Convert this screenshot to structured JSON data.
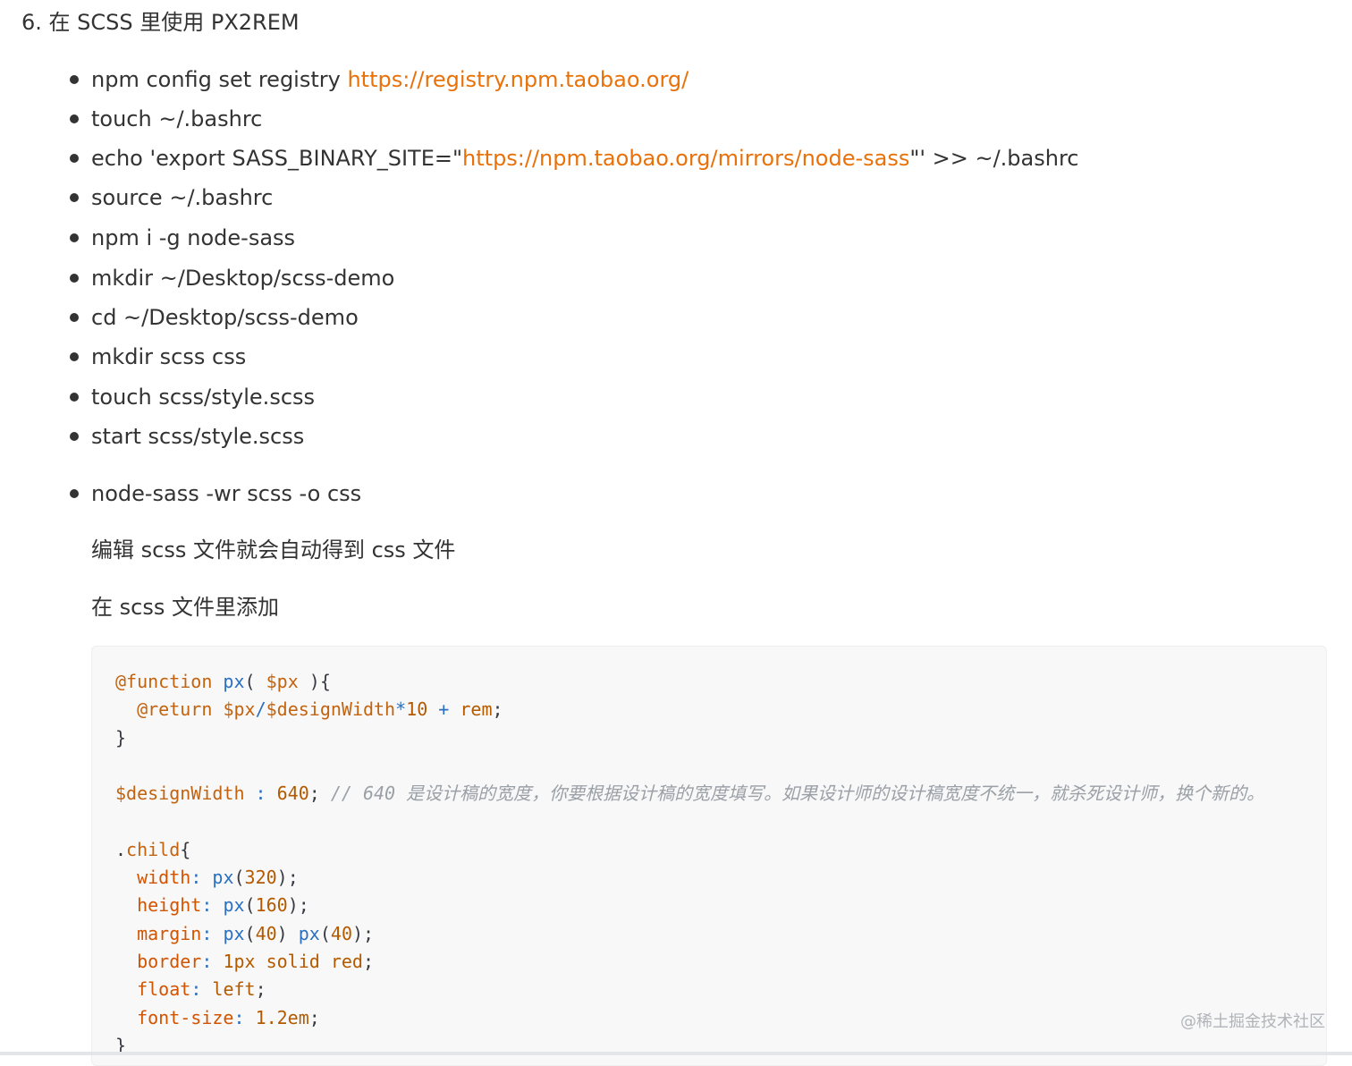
{
  "heading": "6. 在 SCSS 里使用 PX2REM",
  "commands": [
    {
      "pre": "npm config set registry ",
      "link": "https://registry.npm.taobao.org/",
      "post": ""
    },
    {
      "pre": "touch ~/.bashrc",
      "link": "",
      "post": ""
    },
    {
      "pre": "echo 'export SASS_BINARY_SITE=\"",
      "link": "https://npm.taobao.org/mirrors/node-sass",
      "post": "\"' >> ~/.bashrc"
    },
    {
      "pre": "source ~/.bashrc",
      "link": "",
      "post": ""
    },
    {
      "pre": "npm i -g node-sass",
      "link": "",
      "post": ""
    },
    {
      "pre": "mkdir ~/Desktop/scss-demo",
      "link": "",
      "post": ""
    },
    {
      "pre": "cd ~/Desktop/scss-demo",
      "link": "",
      "post": ""
    },
    {
      "pre": "mkdir scss css",
      "link": "",
      "post": ""
    },
    {
      "pre": "touch scss/style.scss",
      "link": "",
      "post": ""
    },
    {
      "pre": "start scss/style.scss",
      "link": "",
      "post": ""
    },
    {
      "pre": "node-sass -wr scss -o css",
      "link": "",
      "post": ""
    }
  ],
  "paragraphs": [
    "编辑 scss 文件就会自动得到 css 文件",
    "在 scss 文件里添加"
  ],
  "code": {
    "l1": {
      "kw": "@function",
      "fn": "px",
      "open": "( ",
      "var": "$px",
      "close": " ){"
    },
    "l2": {
      "kw": "@return",
      "a": "$px",
      "slash": "/",
      "b": "$designWidth",
      "star": "*",
      "num": "10",
      "plus": " + ",
      "unit": "rem",
      "semi": ";"
    },
    "l3": "}",
    "l5": {
      "var": "$designWidth",
      "colon": " : ",
      "num": "640",
      "semi": "; ",
      "comment": "// 640 是设计稿的宽度，你要根据设计稿的宽度填写。如果设计师的设计稿宽度不统一，就杀死设计师，换个新的。"
    },
    "l7": {
      "dot": ".",
      "sel": "child",
      "brace": "{"
    },
    "props": [
      {
        "name": "width",
        "fn": "px",
        "arg": "320",
        "fn2": "",
        "arg2": "",
        "rest": ""
      },
      {
        "name": "height",
        "fn": "px",
        "arg": "160",
        "fn2": "",
        "arg2": "",
        "rest": ""
      },
      {
        "name": "margin",
        "fn": "px",
        "arg": "40",
        "fn2": "px",
        "arg2": "40",
        "rest": ""
      },
      {
        "name": "border",
        "fn": "",
        "arg": "",
        "fn2": "",
        "arg2": "",
        "rest": "1px solid red"
      },
      {
        "name": "float",
        "fn": "",
        "arg": "",
        "fn2": "",
        "arg2": "",
        "rest": "left"
      },
      {
        "name": "font-size",
        "fn": "",
        "arg": "",
        "fn2": "",
        "arg2": "",
        "rest": "1.2em"
      }
    ],
    "end": "}"
  },
  "watermark": "@稀土掘金技术社区"
}
